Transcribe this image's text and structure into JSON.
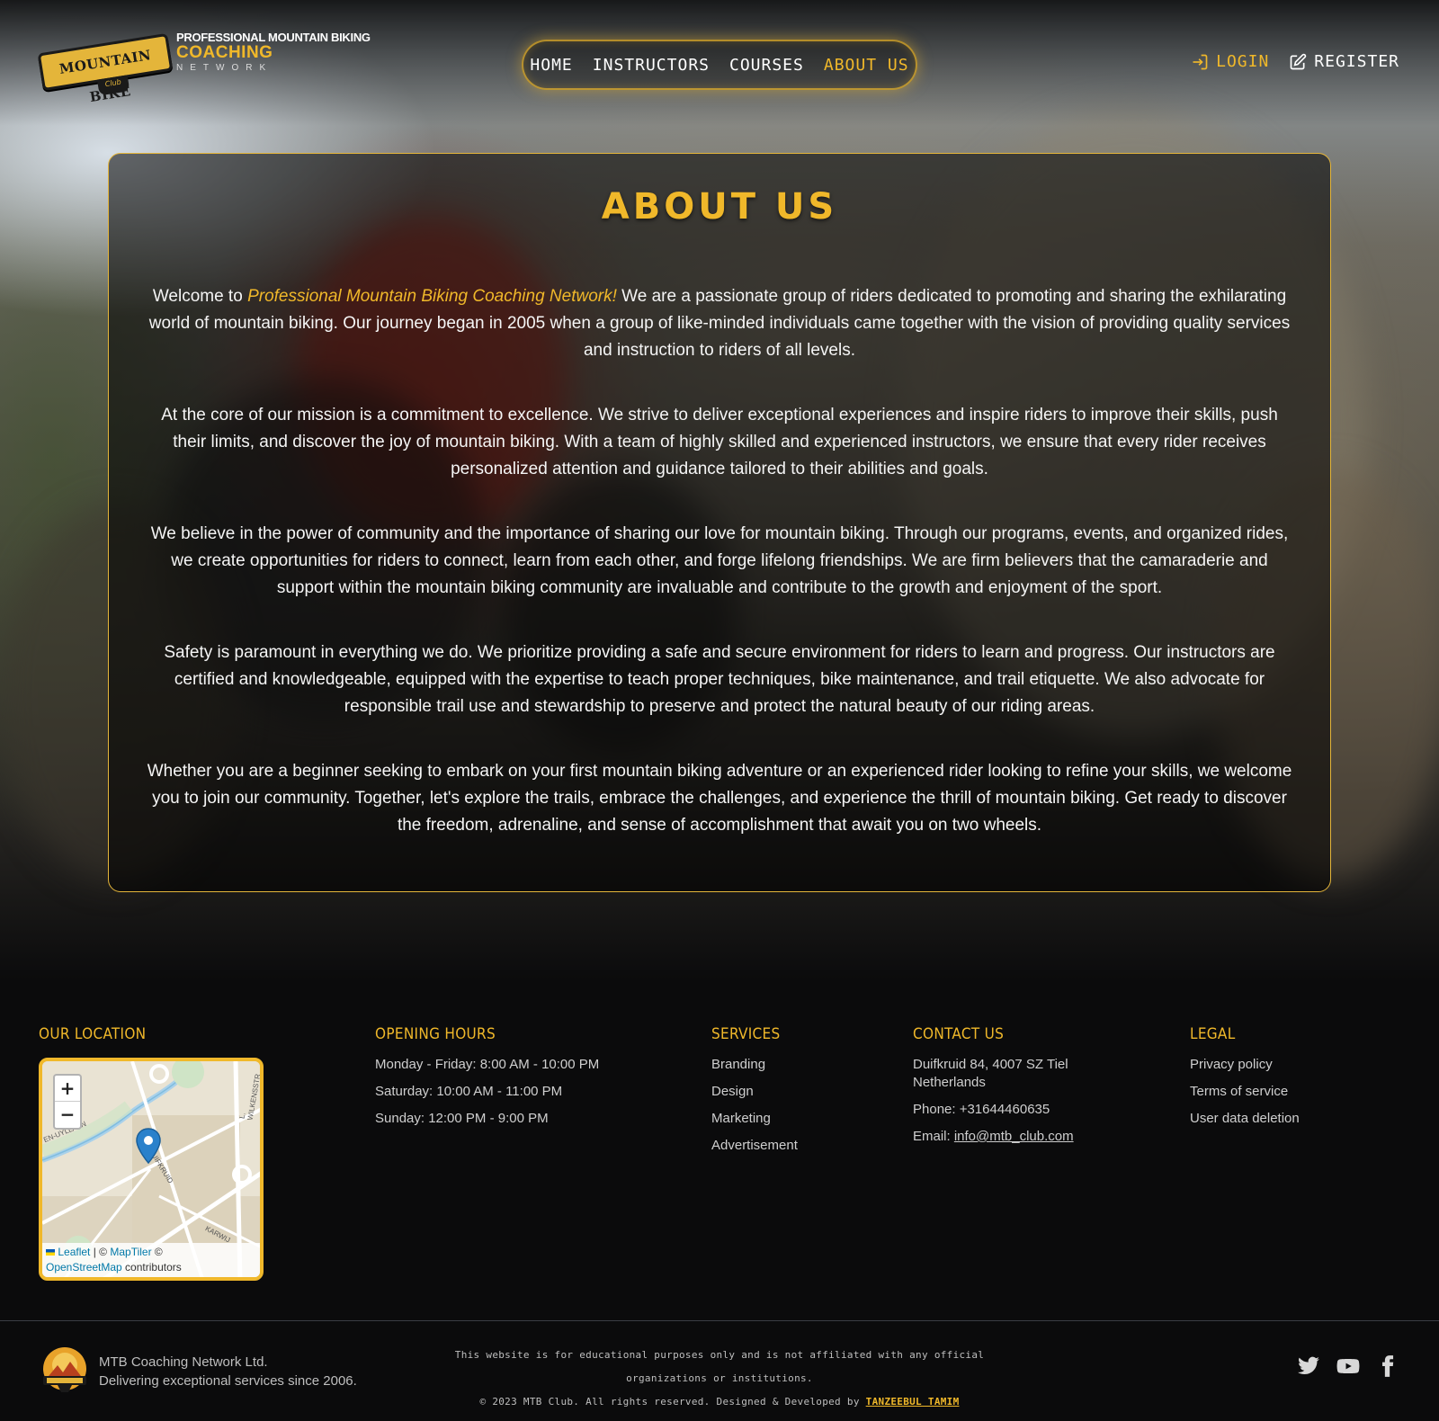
{
  "header": {
    "logo": {
      "badge_text": "MOUNTAIN BIKE",
      "badge_sub": "Club",
      "line1": "PROFESSIONAL MOUNTAIN BIKING",
      "line2": "COACHING",
      "line3": "NETWORK"
    },
    "nav": [
      {
        "label": "HOME",
        "active": false
      },
      {
        "label": "INSTRUCTORS",
        "active": false
      },
      {
        "label": "COURSES",
        "active": false
      },
      {
        "label": "ABOUT US",
        "active": true
      }
    ],
    "login_label": "LOGIN",
    "register_label": "REGISTER"
  },
  "about": {
    "title": "ABOUT US",
    "p1_pre": "Welcome to ",
    "p1_brand": "Professional Mountain Biking Coaching Network!",
    "p1_post": " We are a passionate group of riders dedicated to promoting and sharing the exhilarating world of mountain biking. Our journey began in 2005 when a group of like-minded individuals came together with the vision of providing quality services and instruction to riders of all levels.",
    "p2": "At the core of our mission is a commitment to excellence. We strive to deliver exceptional experiences and inspire riders to improve their skills, push their limits, and discover the joy of mountain biking. With a team of highly skilled and experienced instructors, we ensure that every rider receives personalized attention and guidance tailored to their abilities and goals.",
    "p3": "We believe in the power of community and the importance of sharing our love for mountain biking. Through our programs, events, and organized rides, we create opportunities for riders to connect, learn from each other, and forge lifelong friendships. We are firm believers that the camaraderie and support within the mountain biking community are invaluable and contribute to the growth and enjoyment of the sport.",
    "p4": "Safety is paramount in everything we do. We prioritize providing a safe and secure environment for riders to learn and progress. Our instructors are certified and knowledgeable, equipped with the expertise to teach proper techniques, bike maintenance, and trail etiquette. We also advocate for responsible trail use and stewardship to preserve and protect the natural beauty of our riding areas.",
    "p5": "Whether you are a beginner seeking to embark on your first mountain biking adventure or an experienced rider looking to refine your skills, we welcome you to join our community. Together, let's explore the trails, embrace the challenges, and experience the thrill of mountain biking. Get ready to discover the freedom, adrenaline, and sense of accomplishment that await you on two wheels."
  },
  "footer": {
    "location": {
      "heading": "OUR LOCATION",
      "zoom_in": "+",
      "zoom_out": "−",
      "attr_leaflet": "Leaflet",
      "attr_sep": " | © ",
      "attr_maptiler": "MapTiler",
      "attr_osm": "OpenStreetMap",
      "attr_contrib": " contributors",
      "street_1": "L. WILKENSSTR",
      "street_2": "EN-UYLLAAN",
      "street_3": "DUIFKRUID",
      "street_4": "KARWIJ"
    },
    "hours": {
      "heading": "OPENING HOURS",
      "lines": [
        "Monday - Friday: 8:00 AM - 10:00 PM",
        "Saturday: 10:00 AM - 11:00 PM",
        "Sunday: 12:00 PM - 9:00 PM"
      ]
    },
    "services": {
      "heading": "SERVICES",
      "items": [
        "Branding",
        "Design",
        "Marketing",
        "Advertisement"
      ]
    },
    "contact": {
      "heading": "CONTACT US",
      "address": "Duifkruid 84, 4007 SZ Tiel",
      "country": "Netherlands",
      "phone": "Phone: +31644460635",
      "email_label": "Email: ",
      "email": "info@mtb_club.com"
    },
    "legal": {
      "heading": "LEGAL",
      "items": [
        "Privacy policy",
        "Terms of service",
        "User data deletion"
      ]
    },
    "bottom": {
      "company": "MTB Coaching Network Ltd.",
      "tagline": "Delivering exceptional services since 2006.",
      "disclaimer": "This website is for educational purposes only and is not affiliated with any official organizations or institutions.",
      "copyright": "© 2023 MTB Club. All rights reserved. Designed & Developed by ",
      "author": "TANZEEBUL TAMIM",
      "social": [
        "twitter-icon",
        "youtube-icon",
        "facebook-icon"
      ]
    }
  },
  "colors": {
    "accent": "#f0b82a",
    "background": "#0b0b0c",
    "footer_text": "#cfcfcf"
  }
}
